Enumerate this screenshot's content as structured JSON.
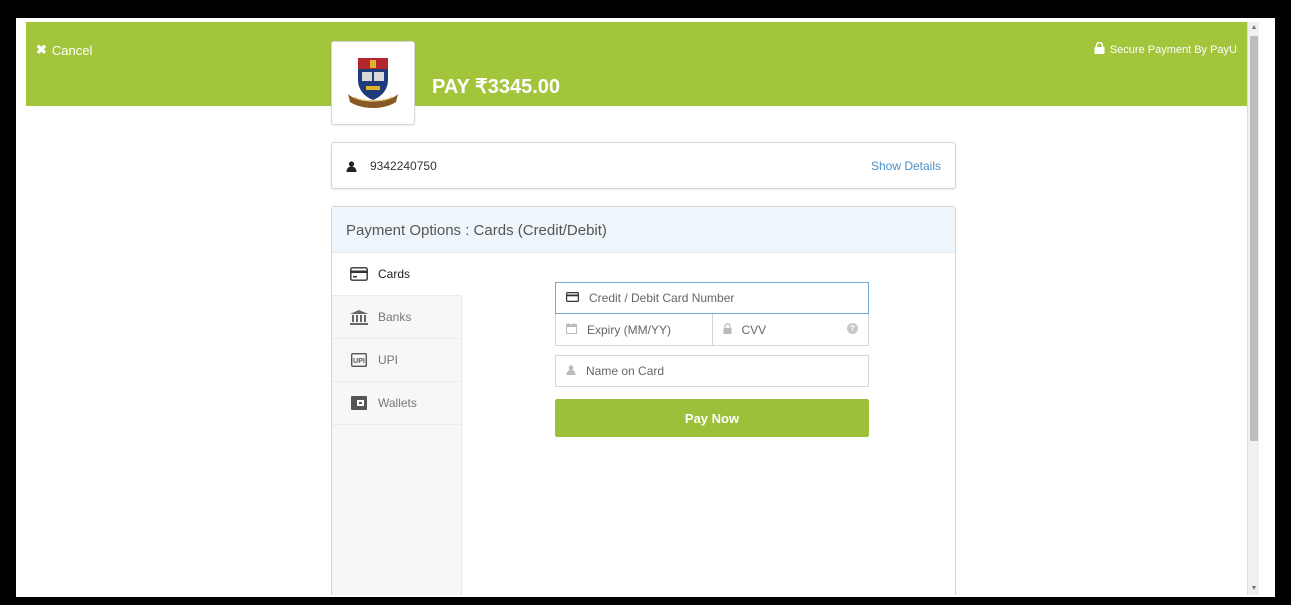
{
  "header": {
    "cancel_label": "Cancel",
    "secure_label": "Secure Payment By PayU",
    "pay_label": "PAY ₹3345.00",
    "accent_color": "#a2c53c"
  },
  "account": {
    "number": "9342240750",
    "show_details_label": "Show Details"
  },
  "payment": {
    "title": "Payment Options : Cards (Credit/Debit)",
    "tabs": [
      {
        "label": "Cards",
        "icon": "credit-card-icon",
        "active": true
      },
      {
        "label": "Banks",
        "icon": "bank-icon",
        "active": false
      },
      {
        "label": "UPI",
        "icon": "upi-icon",
        "active": false
      },
      {
        "label": "Wallets",
        "icon": "wallet-icon",
        "active": false
      }
    ],
    "card_number_placeholder": "Credit / Debit Card Number",
    "expiry_placeholder": "Expiry (MM/YY)",
    "cvv_placeholder": "CVV",
    "name_placeholder": "Name on Card",
    "pay_button_label": "Pay Now"
  }
}
